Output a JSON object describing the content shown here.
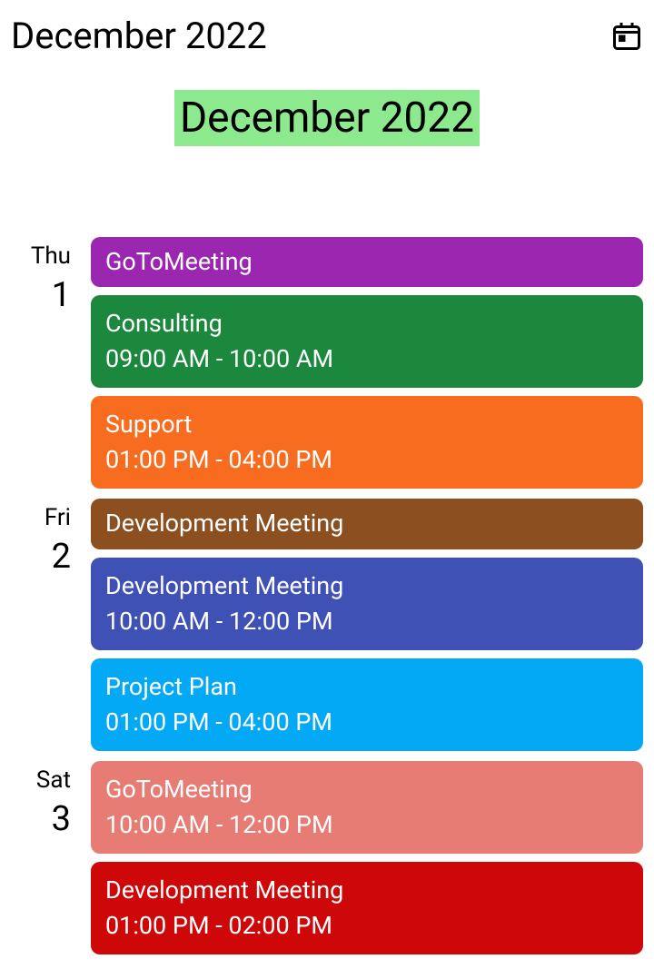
{
  "header": {
    "title": "December 2022"
  },
  "monthTitle": "December 2022",
  "days": [
    {
      "name": "Thu",
      "number": "1",
      "events": [
        {
          "title": "GoToMeeting",
          "time": "",
          "color": "#9b27b0"
        },
        {
          "title": "Consulting",
          "time": "09:00 AM - 10:00 AM",
          "color": "#1b883d"
        },
        {
          "title": "Support",
          "time": "01:00 PM - 04:00 PM",
          "color": "#f86c20"
        }
      ]
    },
    {
      "name": "Fri",
      "number": "2",
      "events": [
        {
          "title": "Development Meeting",
          "time": "",
          "color": "#8b4f20"
        },
        {
          "title": "Development Meeting",
          "time": "10:00 AM - 12:00 PM",
          "color": "#3f51b5"
        },
        {
          "title": "Project Plan",
          "time": "01:00 PM - 04:00 PM",
          "color": "#03a9f4"
        }
      ]
    },
    {
      "name": "Sat",
      "number": "3",
      "events": [
        {
          "title": "GoToMeeting",
          "time": "10:00 AM - 12:00 PM",
          "color": "#e67c73"
        },
        {
          "title": "Development Meeting",
          "time": "01:00 PM - 02:00 PM",
          "color": "#ce0808"
        }
      ]
    }
  ]
}
